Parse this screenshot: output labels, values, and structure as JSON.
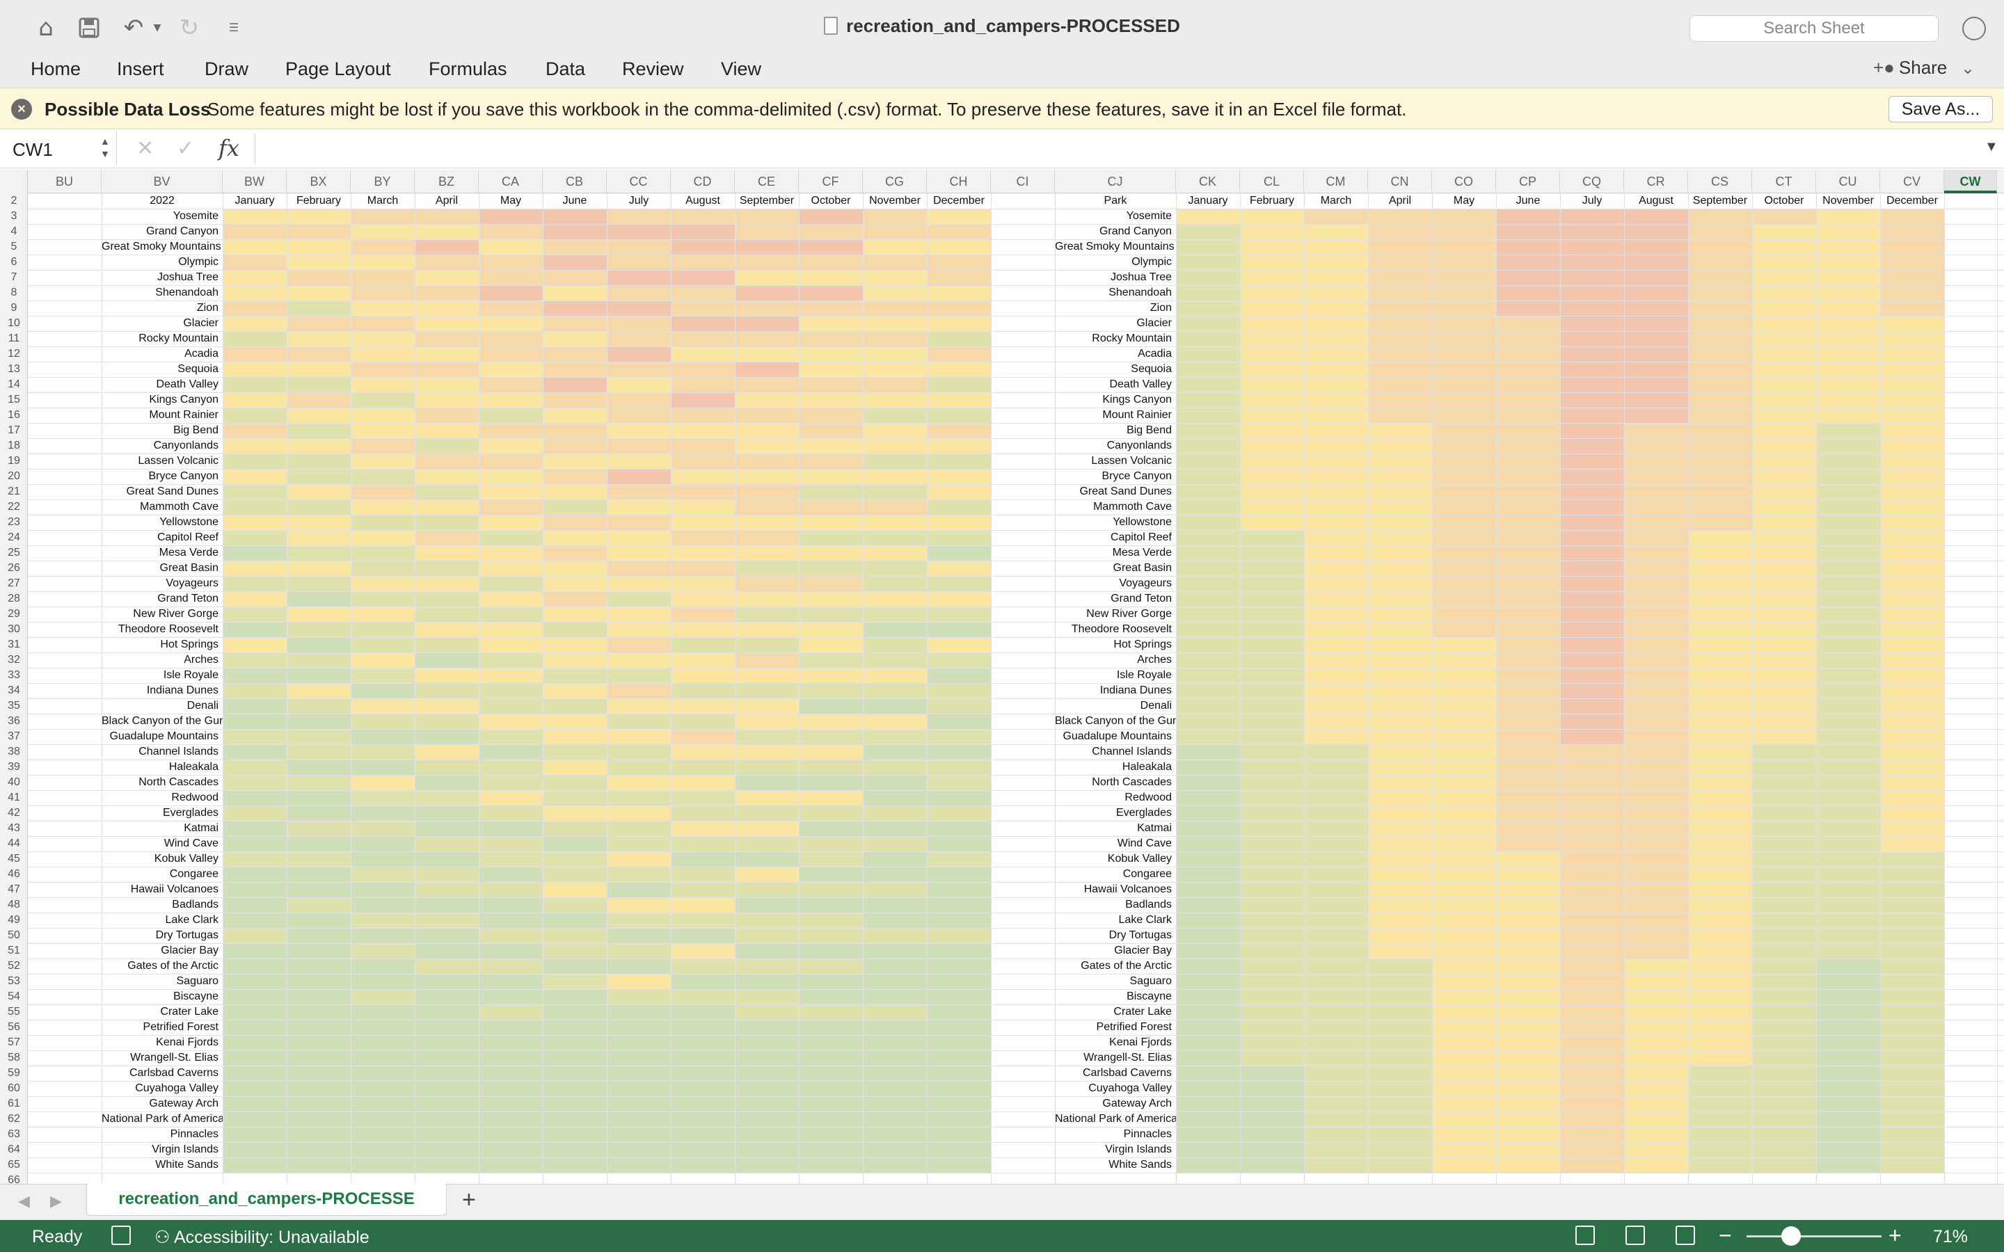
{
  "window": {
    "title": "recreation_and_campers-PROCESSED",
    "search_placeholder": "Search Sheet",
    "icons": [
      "home-icon",
      "save-icon",
      "undo-icon",
      "redo-icon",
      "customize-icon"
    ]
  },
  "ribbon": {
    "tabs": [
      "Home",
      "Insert",
      "Draw",
      "Page Layout",
      "Formulas",
      "Data",
      "Review",
      "View"
    ],
    "share_label": "Share"
  },
  "message_bar": {
    "title": "Possible Data Loss",
    "text": "Some features might be lost if you save this workbook in the comma-delimited (.csv) format. To preserve these features, save it in an Excel file format.",
    "button": "Save As..."
  },
  "formula_bar": {
    "name_box": "CW1",
    "fx_label": "fx",
    "formula": ""
  },
  "grid": {
    "columns_left": [
      "BU",
      "BV",
      "BW",
      "BX",
      "BY",
      "BZ",
      "CA",
      "CB",
      "CC",
      "CD",
      "CE",
      "CF",
      "CG",
      "CH",
      "CI",
      "CJ",
      "CK",
      "CL",
      "CM",
      "CN",
      "CO",
      "CP",
      "CQ",
      "CR",
      "CS",
      "CT",
      "CU",
      "CV",
      "CW"
    ],
    "selected_column": "CW",
    "left_header_label": "2022",
    "right_header_label": "Park",
    "months": [
      "January",
      "February",
      "March",
      "April",
      "May",
      "June",
      "July",
      "August",
      "September",
      "October",
      "November",
      "December"
    ],
    "row_numbers": [
      2,
      3,
      4,
      5,
      6,
      7,
      8,
      9,
      10,
      11,
      12,
      13,
      14,
      15,
      16,
      17,
      18,
      19,
      20,
      21,
      22,
      23,
      24,
      25,
      26,
      27,
      28,
      29,
      30,
      31,
      32,
      33,
      34,
      35,
      36,
      37,
      38,
      39,
      40,
      41,
      42,
      43,
      44,
      45,
      46,
      47,
      48,
      49,
      50,
      51,
      52,
      53,
      54,
      55,
      56,
      57,
      58,
      59,
      60,
      61,
      62,
      63,
      64,
      65,
      66
    ],
    "parks": [
      "Yosemite",
      "Grand Canyon",
      "Great Smoky Mountains",
      "Olympic",
      "Joshua Tree",
      "Shenandoah",
      "Zion",
      "Glacier",
      "Rocky Mountain",
      "Acadia",
      "Sequoia",
      "Death Valley",
      "Kings Canyon",
      "Mount Rainier",
      "Big Bend",
      "Canyonlands",
      "Lassen Volcanic",
      "Bryce Canyon",
      "Great Sand Dunes",
      "Mammoth Cave",
      "Yellowstone",
      "Capitol Reef",
      "Mesa Verde",
      "Great Basin",
      "Voyageurs",
      "Grand Teton",
      "New River Gorge",
      "Theodore Roosevelt",
      "Hot Springs",
      "Arches",
      "Isle Royale",
      "Indiana Dunes",
      "Denali",
      "Black Canyon of the Gunnison",
      "Guadalupe Mountains",
      "Channel Islands",
      "Haleakala",
      "North Cascades",
      "Redwood",
      "Everglades",
      "Katmai",
      "Wind Cave",
      "Kobuk Valley",
      "Congaree",
      "Hawaii Volcanoes",
      "Badlands",
      "Lake Clark",
      "Dry Tortugas",
      "Glacier Bay",
      "Gates of the Arctic",
      "Saguaro",
      "Biscayne",
      "Crater Lake",
      "Petrified Forest",
      "Kenai Fjords",
      "Wrangell-St. Elias",
      "Carlsbad Caverns",
      "Cuyahoga Valley",
      "Gateway Arch",
      "National Park of American Samoa",
      "Pinnacles",
      "Virgin Islands",
      "White Sands"
    ],
    "heat_colors": {
      "red": "#f3c6ad",
      "orange": "#f7d8a9",
      "yellow": "#fbe6a1",
      "lightgreen": "#dfe3ab",
      "green": "#cfe0b8"
    }
  },
  "sheet_tabs": {
    "active": "recreation_and_campers-PROCESSE",
    "add_label": "+"
  },
  "status_bar": {
    "ready": "Ready",
    "accessibility": "Accessibility: Unavailable",
    "zoom": "71%"
  }
}
